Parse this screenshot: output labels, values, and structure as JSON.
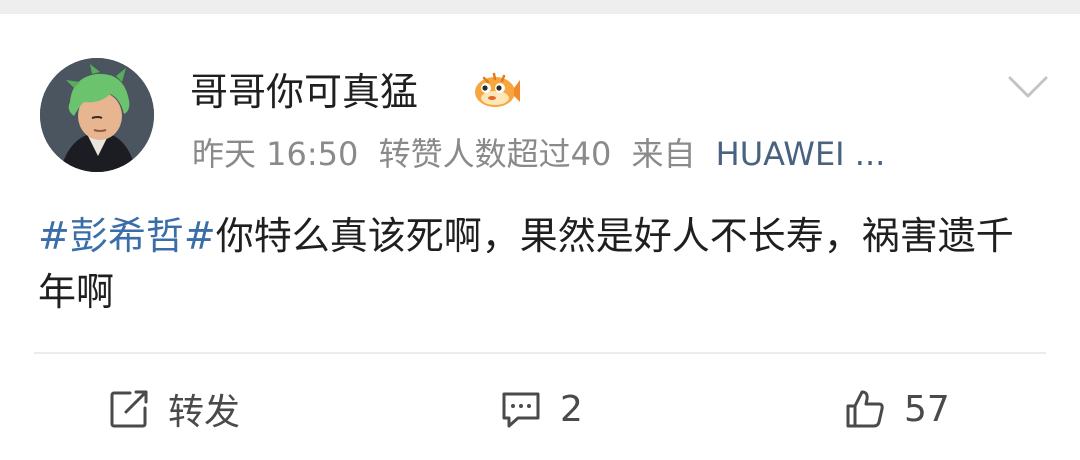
{
  "post": {
    "username": "哥哥你可真猛",
    "meta": {
      "time": "昨天 16:50",
      "repost_status": "转赞人数超过40",
      "source_prefix": "来自",
      "source": "HUAWEI ..."
    },
    "hashtag": "#彭希哲#",
    "body": "你特么真该死啊，果然是好人不长寿，祸害遗千年啊",
    "icons": {
      "avatar": "green-haired-anime-avatar",
      "badge": "pufferfish-emoji-badge",
      "menu": "chevron-down-icon"
    }
  },
  "actions": {
    "repost_label": "转发",
    "comment_count": "2",
    "like_count": "57"
  },
  "colors": {
    "hashtag": "#3b6ea8",
    "source": "#49627f",
    "meta": "#8a8a8a",
    "text": "#1f1f1f"
  }
}
